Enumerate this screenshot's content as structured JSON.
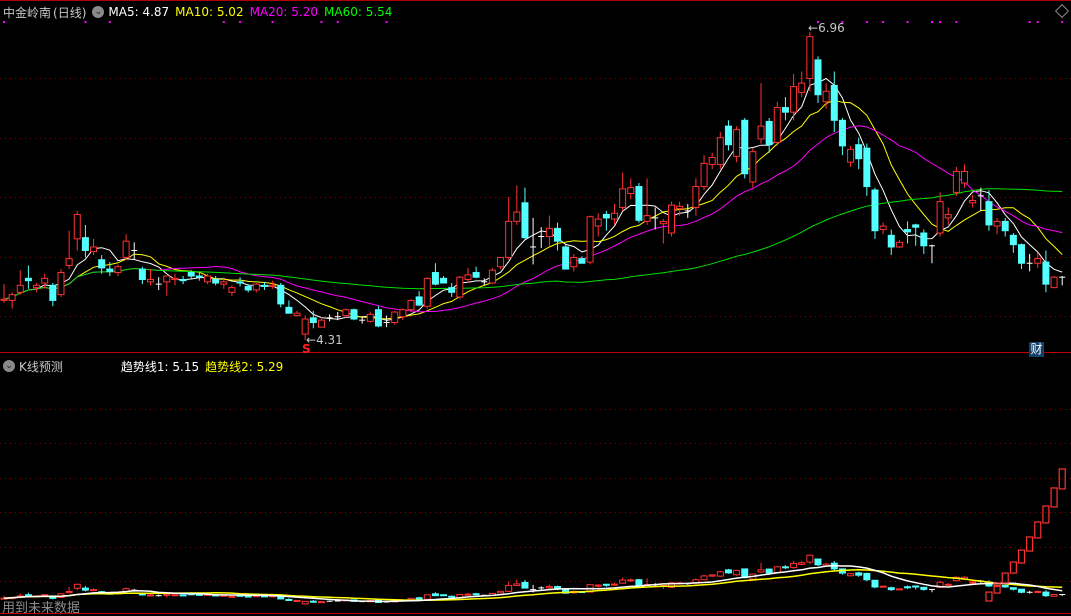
{
  "header": {
    "stock_name": "中金岭南",
    "period": "(日线)",
    "ma5": "MA5: 4.87",
    "ma10": "MA10: 5.02",
    "ma20": "MA20: 5.20",
    "ma60": "MA60: 5.54"
  },
  "sub_header": {
    "indicator": "K线预测",
    "trend1": "趋势线1: 5.15",
    "trend2": "趋势线2: 5.29"
  },
  "annotations": {
    "high_label": "6.96",
    "low_label": "4.31",
    "signal_s": "S",
    "finance_badge": "财",
    "future_data_warning": "用到未来数据"
  },
  "colors": {
    "up": "#ff3232",
    "down": "#54ffff",
    "ma5": "#ffffff",
    "ma10": "#ffff00",
    "ma20": "#ff00ff",
    "ma60": "#00e000",
    "grid": "#8b0000"
  },
  "chart_data": {
    "type": "candlestick",
    "title": "中金岭南 (日线)",
    "price_range": [
      4.31,
      6.96
    ],
    "high": 6.96,
    "low": 4.31,
    "moving_averages": [
      5,
      10,
      20,
      60
    ],
    "candles_ohlc": [
      [
        4.65,
        4.79,
        4.63,
        4.66
      ],
      [
        4.65,
        4.72,
        4.58,
        4.7
      ],
      [
        4.72,
        4.91,
        4.7,
        4.78
      ],
      [
        4.84,
        4.95,
        4.75,
        4.82
      ],
      [
        4.76,
        4.8,
        4.72,
        4.78
      ],
      [
        4.8,
        4.88,
        4.75,
        4.84
      ],
      [
        4.78,
        4.8,
        4.6,
        4.65
      ],
      [
        4.7,
        4.92,
        4.68,
        4.89
      ],
      [
        4.95,
        5.25,
        4.92,
        5.01
      ],
      [
        5.18,
        5.42,
        5.08,
        5.39
      ],
      [
        5.19,
        5.3,
        5.02,
        5.08
      ],
      [
        5.07,
        5.18,
        5.04,
        5.11
      ],
      [
        5.0,
        5.04,
        4.88,
        4.93
      ],
      [
        4.92,
        4.98,
        4.86,
        4.9
      ],
      [
        4.89,
        4.96,
        4.86,
        4.94
      ],
      [
        5.02,
        5.22,
        5.0,
        5.16
      ],
      [
        5.08,
        5.15,
        5.0,
        5.08
      ],
      [
        4.92,
        4.94,
        4.79,
        4.83
      ],
      [
        4.81,
        4.92,
        4.78,
        4.83
      ],
      [
        4.79,
        4.85,
        4.74,
        4.79
      ],
      [
        4.81,
        4.86,
        4.69,
        4.86
      ],
      [
        4.83,
        4.88,
        4.78,
        4.84
      ],
      [
        4.83,
        4.86,
        4.79,
        4.82
      ],
      [
        4.89,
        4.91,
        4.84,
        4.86
      ],
      [
        4.86,
        4.89,
        4.82,
        4.85
      ],
      [
        4.81,
        4.88,
        4.79,
        4.86
      ],
      [
        4.83,
        4.86,
        4.78,
        4.8
      ],
      [
        4.79,
        4.85,
        4.75,
        4.81
      ],
      [
        4.72,
        4.78,
        4.69,
        4.76
      ],
      [
        4.81,
        4.85,
        4.77,
        4.8
      ],
      [
        4.77,
        4.79,
        4.72,
        4.74
      ],
      [
        4.74,
        4.8,
        4.72,
        4.79
      ],
      [
        4.78,
        4.81,
        4.74,
        4.77
      ],
      [
        4.77,
        4.82,
        4.75,
        4.78
      ],
      [
        4.78,
        4.8,
        4.59,
        4.62
      ],
      [
        4.59,
        4.65,
        4.54,
        4.54
      ],
      [
        4.52,
        4.56,
        4.51,
        4.54
      ],
      [
        4.36,
        4.52,
        4.31,
        4.49
      ],
      [
        4.5,
        4.56,
        4.41,
        4.46
      ],
      [
        4.42,
        4.51,
        4.42,
        4.48
      ],
      [
        4.5,
        4.53,
        4.47,
        4.5
      ],
      [
        4.51,
        4.55,
        4.48,
        4.51
      ],
      [
        4.52,
        4.58,
        4.5,
        4.57
      ],
      [
        4.57,
        4.58,
        4.48,
        4.49
      ],
      [
        4.48,
        4.51,
        4.45,
        4.48
      ],
      [
        4.47,
        4.55,
        4.46,
        4.53
      ],
      [
        4.57,
        4.6,
        4.42,
        4.43
      ],
      [
        4.46,
        4.52,
        4.42,
        4.46
      ],
      [
        4.46,
        4.56,
        4.44,
        4.55
      ],
      [
        4.51,
        4.58,
        4.48,
        4.57
      ],
      [
        4.57,
        4.66,
        4.55,
        4.65
      ],
      [
        4.68,
        4.73,
        4.6,
        4.61
      ],
      [
        4.6,
        4.85,
        4.58,
        4.84
      ],
      [
        4.89,
        4.97,
        4.78,
        4.79
      ],
      [
        4.84,
        4.86,
        4.8,
        4.8
      ],
      [
        4.76,
        4.8,
        4.68,
        4.72
      ],
      [
        4.68,
        4.86,
        4.66,
        4.85
      ],
      [
        4.83,
        4.93,
        4.8,
        4.87
      ],
      [
        4.89,
        4.94,
        4.84,
        4.85
      ],
      [
        4.81,
        4.84,
        4.78,
        4.81
      ],
      [
        4.8,
        4.93,
        4.79,
        4.91
      ],
      [
        4.94,
        5.02,
        4.92,
        5.02
      ],
      [
        5.02,
        5.54,
        5.0,
        5.33
      ],
      [
        5.33,
        5.64,
        5.3,
        5.41
      ],
      [
        5.49,
        5.62,
        5.18,
        5.19
      ],
      [
        5.11,
        5.36,
        4.96,
        5.11
      ],
      [
        5.2,
        5.28,
        5.1,
        5.2
      ],
      [
        5.2,
        5.38,
        5.12,
        5.27
      ],
      [
        5.27,
        5.32,
        5.08,
        5.16
      ],
      [
        5.11,
        5.13,
        4.92,
        4.92
      ],
      [
        4.94,
        5.05,
        4.9,
        5.02
      ],
      [
        5.01,
        5.03,
        4.97,
        4.97
      ],
      [
        4.98,
        5.38,
        4.96,
        5.37
      ],
      [
        5.29,
        5.4,
        5.2,
        5.35
      ],
      [
        5.39,
        5.42,
        5.25,
        5.36
      ],
      [
        5.35,
        5.48,
        5.3,
        5.4
      ],
      [
        5.45,
        5.75,
        5.42,
        5.61
      ],
      [
        5.57,
        5.7,
        5.52,
        5.62
      ],
      [
        5.63,
        5.66,
        5.32,
        5.34
      ],
      [
        5.33,
        5.7,
        5.3,
        5.38
      ],
      [
        5.36,
        5.45,
        5.26,
        5.36
      ],
      [
        5.31,
        5.35,
        5.14,
        5.33
      ],
      [
        5.23,
        5.5,
        5.2,
        5.47
      ],
      [
        5.44,
        5.5,
        5.38,
        5.46
      ],
      [
        5.42,
        5.48,
        5.36,
        5.42
      ],
      [
        5.45,
        5.7,
        5.38,
        5.63
      ],
      [
        5.63,
        5.9,
        5.6,
        5.83
      ],
      [
        5.82,
        5.92,
        5.78,
        5.88
      ],
      [
        5.82,
        6.1,
        5.78,
        6.05
      ],
      [
        6.15,
        6.2,
        5.94,
        5.99
      ],
      [
        5.89,
        6.15,
        5.84,
        6.12
      ],
      [
        6.2,
        6.22,
        5.7,
        5.74
      ],
      [
        5.67,
        5.96,
        5.62,
        5.93
      ],
      [
        6.04,
        6.52,
        6.0,
        6.15
      ],
      [
        6.19,
        6.22,
        5.92,
        5.99
      ],
      [
        6.01,
        6.36,
        5.98,
        6.31
      ],
      [
        6.31,
        6.4,
        6.2,
        6.27
      ],
      [
        6.27,
        6.6,
        6.2,
        6.49
      ],
      [
        6.44,
        6.62,
        6.4,
        6.52
      ],
      [
        6.56,
        6.96,
        6.45,
        6.92
      ],
      [
        6.72,
        6.75,
        6.35,
        6.42
      ],
      [
        6.36,
        6.52,
        6.3,
        6.45
      ],
      [
        6.5,
        6.62,
        6.1,
        6.2
      ],
      [
        6.2,
        6.22,
        5.9,
        5.98
      ],
      [
        5.84,
        5.98,
        5.8,
        5.95
      ],
      [
        5.99,
        6.05,
        5.78,
        5.87
      ],
      [
        5.96,
        6.0,
        5.55,
        5.63
      ],
      [
        5.6,
        5.62,
        5.18,
        5.25
      ],
      [
        5.26,
        5.32,
        5.22,
        5.29
      ],
      [
        5.21,
        5.26,
        5.04,
        5.11
      ],
      [
        5.11,
        5.17,
        5.1,
        5.15
      ],
      [
        5.26,
        5.33,
        5.14,
        5.24
      ],
      [
        5.3,
        5.31,
        5.12,
        5.28
      ],
      [
        5.23,
        5.26,
        5.05,
        5.12
      ],
      [
        5.12,
        5.13,
        4.97,
        5.12
      ],
      [
        5.23,
        5.58,
        5.2,
        5.5
      ],
      [
        5.36,
        5.45,
        5.3,
        5.39
      ],
      [
        5.58,
        5.8,
        5.55,
        5.76
      ],
      [
        5.66,
        5.82,
        5.62,
        5.76
      ],
      [
        5.49,
        5.56,
        5.45,
        5.51
      ],
      [
        5.55,
        5.62,
        5.42,
        5.55
      ],
      [
        5.5,
        5.6,
        5.25,
        5.3
      ],
      [
        5.29,
        5.36,
        5.22,
        5.33
      ],
      [
        5.33,
        5.36,
        5.2,
        5.25
      ],
      [
        5.21,
        5.23,
        5.06,
        5.13
      ],
      [
        5.13,
        5.14,
        4.92,
        4.97
      ],
      [
        4.97,
        5.05,
        4.9,
        4.97
      ],
      [
        4.97,
        5.06,
        4.93,
        5.01
      ],
      [
        4.98,
        5.08,
        4.72,
        4.79
      ],
      [
        4.76,
        4.86,
        4.76,
        4.85
      ],
      [
        4.85,
        4.86,
        4.78,
        4.85
      ]
    ],
    "signal_dot_indices": [
      0,
      10,
      13,
      27,
      29,
      33,
      39,
      41,
      47,
      100,
      103,
      106,
      108,
      111,
      114,
      115,
      117,
      126,
      127,
      130
    ],
    "forecast": {
      "name": "K线预测",
      "start_index": 121,
      "boxes_open_close": [
        [
          4.51,
          4.98
        ],
        [
          4.93,
          5.46
        ],
        [
          5.46,
          5.98
        ],
        [
          5.98,
          6.56
        ],
        [
          6.51,
          7.19
        ],
        [
          7.14,
          7.88
        ],
        [
          7.83,
          8.67
        ],
        [
          8.62,
          9.51
        ],
        [
          9.46,
          10.46
        ],
        [
          10.41,
          11.46
        ]
      ],
      "trend1_last": 5.15,
      "trend2_last": 5.29
    }
  }
}
